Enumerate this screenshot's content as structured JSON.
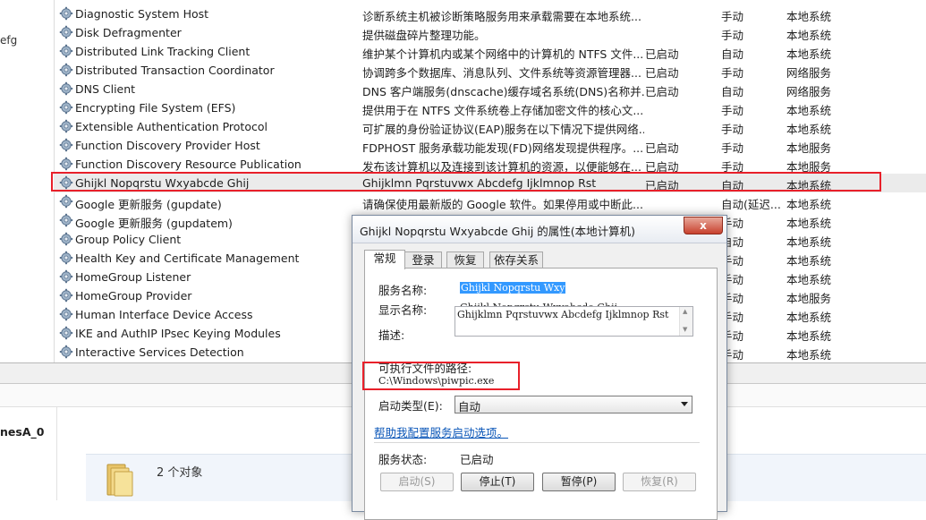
{
  "left_pane": {
    "fragment": "efg",
    "bottom_label": "nesA_0"
  },
  "services": [
    {
      "name": "Diagnostic System Host",
      "desc": "诊断系统主机被诊断策略服务用来承载需要在本地系统...",
      "status": "",
      "startup": "手动",
      "logon": "本地系统"
    },
    {
      "name": "Disk Defragmenter",
      "desc": "提供磁盘碎片整理功能。",
      "status": "",
      "startup": "手动",
      "logon": "本地系统"
    },
    {
      "name": "Distributed Link Tracking Client",
      "desc": "维护某个计算机内或某个网络中的计算机的 NTFS 文件...",
      "status": "已启动",
      "startup": "自动",
      "logon": "本地系统"
    },
    {
      "name": "Distributed Transaction Coordinator",
      "desc": "协调跨多个数据库、消息队列、文件系统等资源管理器...",
      "status": "已启动",
      "startup": "手动",
      "logon": "网络服务"
    },
    {
      "name": "DNS Client",
      "desc": "DNS 客户端服务(dnscache)缓存域名系统(DNS)名称并...",
      "status": "已启动",
      "startup": "自动",
      "logon": "网络服务"
    },
    {
      "name": "Encrypting File System (EFS)",
      "desc": "提供用于在 NTFS 文件系统卷上存储加密文件的核心文...",
      "status": "",
      "startup": "手动",
      "logon": "本地系统"
    },
    {
      "name": "Extensible Authentication Protocol",
      "desc": "可扩展的身份验证协议(EAP)服务在以下情况下提供网络...",
      "status": "",
      "startup": "手动",
      "logon": "本地系统"
    },
    {
      "name": "Function Discovery Provider Host",
      "desc": "FDPHOST 服务承载功能发现(FD)网络发现提供程序。...",
      "status": "已启动",
      "startup": "手动",
      "logon": "本地服务"
    },
    {
      "name": "Function Discovery Resource Publication",
      "desc": "发布该计算机以及连接到该计算机的资源，以便能够在...",
      "status": "已启动",
      "startup": "手动",
      "logon": "本地服务"
    },
    {
      "name": "Ghijkl Nopqrstu Wxyabcde Ghij",
      "desc": "Ghijklmn Pqrstuvwx Abcdefg Ijklmnop Rst",
      "status": "已启动",
      "startup": "自动",
      "logon": "本地系统"
    },
    {
      "name": "Google 更新服务 (gupdate)",
      "desc": "请确保使用最新版的 Google 软件。如果停用或中断此...",
      "status": "",
      "startup": "自动(延迟...",
      "logon": "本地系统"
    },
    {
      "name": "Google 更新服务 (gupdatem)",
      "desc": "",
      "status": "",
      "startup": "手动",
      "logon": "本地系统"
    },
    {
      "name": "Group Policy Client",
      "desc": "",
      "status": "",
      "startup": "自动",
      "logon": "本地系统"
    },
    {
      "name": "Health Key and Certificate Management",
      "desc": "",
      "status": "",
      "startup": "手动",
      "logon": "本地系统"
    },
    {
      "name": "HomeGroup Listener",
      "desc": "",
      "status": "",
      "startup": "手动",
      "logon": "本地系统"
    },
    {
      "name": "HomeGroup Provider",
      "desc": "",
      "status": "",
      "startup": "手动",
      "logon": "本地服务"
    },
    {
      "name": "Human Interface Device Access",
      "desc": "",
      "status": "",
      "startup": "手动",
      "logon": "本地系统"
    },
    {
      "name": "IKE and AuthIP IPsec Keying Modules",
      "desc": "",
      "status": "",
      "startup": "手动",
      "logon": "本地系统"
    },
    {
      "name": "Interactive Services Detection",
      "desc": "",
      "status": "",
      "startup": "手动",
      "logon": "本地系统"
    }
  ],
  "selected_index": 9,
  "bottom": {
    "object_count": "2 个对象"
  },
  "dialog": {
    "title": "Ghijkl Nopqrstu Wxyabcde Ghij 的属性(本地计算机)",
    "close": "x",
    "tabs": [
      "常规",
      "登录",
      "恢复",
      "依存关系"
    ],
    "service_name_label": "服务名称:",
    "service_name": "Ghijkl Nopqrstu Wxy",
    "display_name_label": "显示名称:",
    "display_name": "Ghijkl Nopqrstu Wxyabcde Ghij",
    "description_label": "描述:",
    "description": "Ghijklmn Pqrstuvwx Abcdefg Ijklmnop Rst",
    "exe_path_label": "可执行文件的路径:",
    "exe_path": "C:\\Windows\\piwpic.exe",
    "startup_type_label": "启动类型(E):",
    "startup_type": "自动",
    "help_link": "帮助我配置服务启动选项。",
    "status_label": "服务状态:",
    "status_value": "已启动",
    "buttons": {
      "start": "启动(S)",
      "stop": "停止(T)",
      "pause": "暂停(P)",
      "resume": "恢复(R)"
    }
  }
}
